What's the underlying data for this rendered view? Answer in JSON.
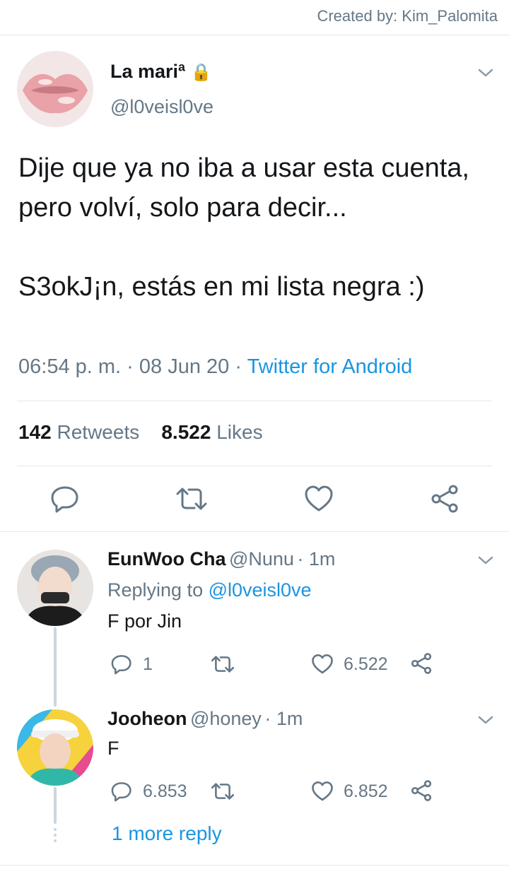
{
  "credit": "Created by: Kim_Palomita",
  "tweet": {
    "author_name": "La mariª",
    "lock_icon": "🔒",
    "handle": "@l0veisl0ve",
    "text": "Dije que ya no iba a usar esta cuenta, pero volví, solo para decir...\n\nS3okJ¡n, estás en mi lista negra :)",
    "time": "06:54 p. m.",
    "sep1": "·",
    "date": "08 Jun 20",
    "sep2": "·",
    "source": "Twitter for Android",
    "retweets_count": "142",
    "retweets_label": "Retweets",
    "likes_count": "8.522",
    "likes_label": "Likes"
  },
  "replies": [
    {
      "name": "EunWoo Cha",
      "handle": "@Nunu",
      "time": "· 1m",
      "replying_prefix": "Replying to",
      "replying_to": "@l0veisl0ve",
      "text": "F por Jin",
      "reply_count": "1",
      "retweet_count": "",
      "like_count": "6.522"
    },
    {
      "name": "Jooheon",
      "handle": "@honey",
      "time": "· 1m",
      "text": "F",
      "reply_count": "6.853",
      "retweet_count": "",
      "like_count": "6.852"
    }
  ],
  "more_replies": "1 more reply",
  "colors": {
    "accent": "#1b95e0",
    "muted": "#657786",
    "border": "#e1e8ed",
    "text": "#14171a"
  },
  "icons": {
    "reply": "reply-icon",
    "retweet": "retweet-icon",
    "like": "heart-icon",
    "share": "share-icon",
    "chevron": "chevron-down-icon"
  }
}
